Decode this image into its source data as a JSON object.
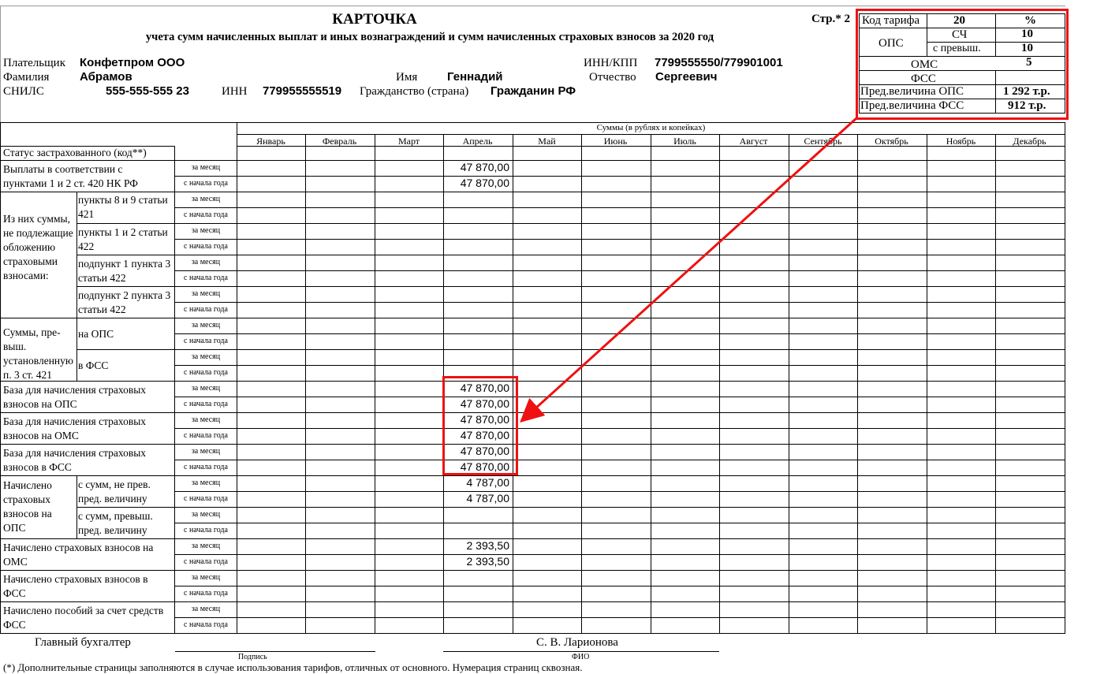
{
  "header": {
    "title": "КАРТОЧКА",
    "subtitle": "учета сумм начисленных выплат и иных вознаграждений и сумм начисленных страховых взносов за 2020 год",
    "page_label": "Стр.* 2"
  },
  "payer": {
    "payer_label": "Плательщик",
    "payer_value": "Конфетпром ООО",
    "inn_kpp_label": "ИНН/КПП",
    "inn_kpp_value": "7799555550/779901001",
    "surname_label": "Фамилия",
    "surname_value": "Абрамов",
    "name_label": "Имя",
    "name_value": "Геннадий",
    "patronymic_label": "Отчество",
    "patronymic_value": "Сергеевич",
    "snils_label": "СНИЛС",
    "snils_value": "555-555-555 23",
    "inn_label": "ИНН",
    "inn_value": "779955555519",
    "citizenship_label": "Гражданство (страна)",
    "citizenship_value": "Гражданин РФ"
  },
  "tariff": {
    "code_label": "Код тарифа",
    "code_value": "20",
    "percent_label": "%",
    "ops_label": "ОПС",
    "sch_label": "СЧ",
    "sch_value": "10",
    "excess_label": "с превыш.",
    "excess_value": "10",
    "oms_label": "ОМС",
    "oms_value": "5",
    "fss_label": "ФСС",
    "limit_ops_label": "Пред.величина ОПС",
    "limit_ops_value": "1 292 т.р.",
    "limit_fss_label": "Пред.величина ФСС",
    "limit_fss_value": "912 т.р."
  },
  "table": {
    "sums_header": "Суммы (в рублях и копейках)",
    "months": [
      "Январь",
      "Февраль",
      "Март",
      "Апрель",
      "Май",
      "Июнь",
      "Июль",
      "Август",
      "Сентябрь",
      "Октябрь",
      "Ноябрь",
      "Декабрь"
    ],
    "status_label": "Статус застрахованного (код**)",
    "period_month": "за месяц",
    "period_year": "с начала года",
    "payments_label": "Выплаты в соответствии с пунктами 1 и 2 ст. 420 НК РФ",
    "exempt_group_label": "Из них суммы, не подлежащие обложению страховыми взносами:",
    "exempt_1": "пункты 8 и 9 статьи 421",
    "exempt_2": "пункты 1 и 2 статьи 422",
    "exempt_3": "подпункт 1 пункта 3 статьи 422",
    "exempt_4": "подпункт 2 пункта 3 статьи 422",
    "excess_group_label": "Суммы, пре-выш. установленную п. 3 ст. 421",
    "excess_ops": "на ОПС",
    "excess_fss": "в ФСС",
    "base_ops_label": "База для начисления страховых взносов на ОПС",
    "base_oms_label": "База для начисления страховых взносов на ОМС",
    "base_fss_label": "База для начисления страховых взносов в ФСС",
    "accrued_ops_group": "Начислено страховых взносов на ОПС",
    "accrued_ops_1": "с сумм, не прев. пред. величину",
    "accrued_ops_2": "с сумм, превыш. пред. величину",
    "accrued_oms_label": "Начислено страховых взносов на ОМС",
    "accrued_fss_label": "Начислено страховых взносов в ФСС",
    "benefits_label": "Начислено пособий за счет средств ФСС",
    "april_values": {
      "payments_month": "47 870,00",
      "payments_year": "47 870,00",
      "base_ops_month": "47 870,00",
      "base_ops_year": "47 870,00",
      "base_oms_month": "47 870,00",
      "base_oms_year": "47 870,00",
      "base_fss_month": "47 870,00",
      "base_fss_year": "47 870,00",
      "accrued_ops_month": "4 787,00",
      "accrued_ops_year": "4 787,00",
      "accrued_oms_month": "2 393,50",
      "accrued_oms_year": "2 393,50"
    }
  },
  "footer": {
    "accountant_label": "Главный бухгалтер",
    "accountant_name": "С. В. Ларионова",
    "signature_caption": "Подпись",
    "fio_caption": "ФИО",
    "note": "(*) Дополнительные страницы заполняются в случае использования тарифов, отличных от основного. Нумерация страниц сквозная."
  },
  "annotation_colors": {
    "highlight": "#ee1111"
  }
}
